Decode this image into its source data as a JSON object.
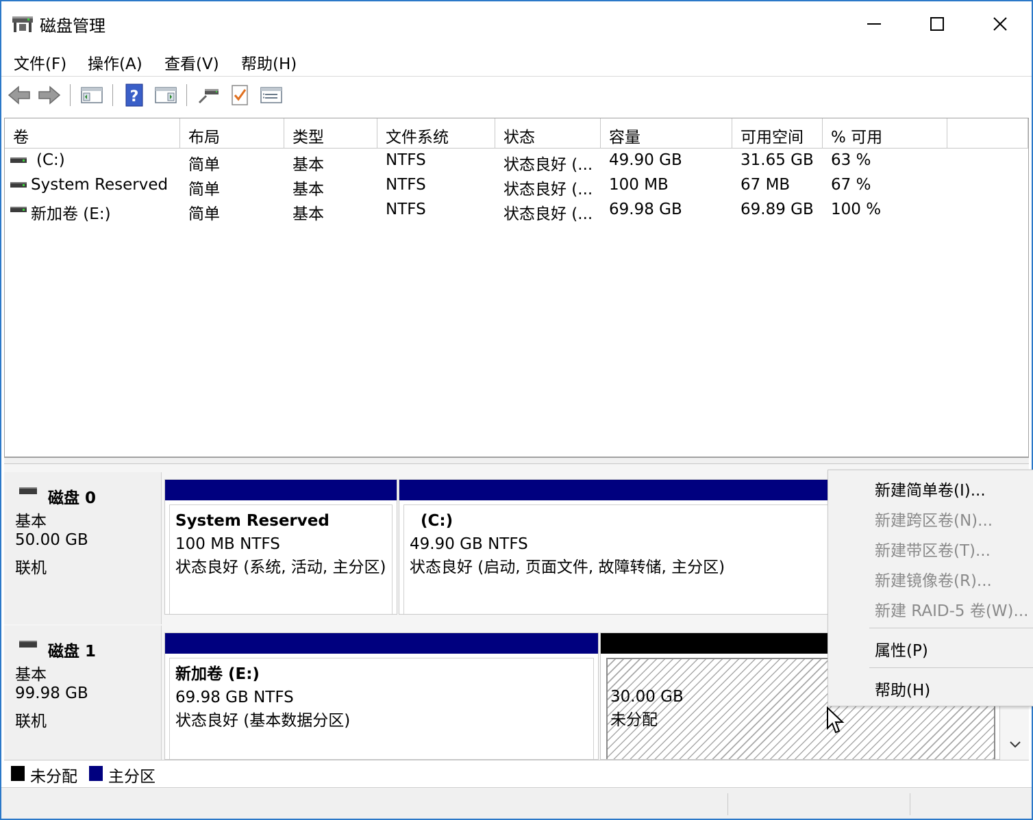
{
  "window": {
    "title": "磁盘管理"
  },
  "menu": {
    "file": "文件(F)",
    "action": "操作(A)",
    "view": "查看(V)",
    "help": "帮助(H)"
  },
  "volume_list": {
    "columns": [
      "卷",
      "布局",
      "类型",
      "文件系统",
      "状态",
      "容量",
      "可用空间",
      "% 可用"
    ],
    "rows": [
      [
        "(C:)",
        "简单",
        "基本",
        "NTFS",
        "状态良好 (...",
        "49.90 GB",
        "31.65 GB",
        "63 %"
      ],
      [
        "System Reserved",
        "简单",
        "基本",
        "NTFS",
        "状态良好 (...",
        "100 MB",
        "67 MB",
        "67 %"
      ],
      [
        "新加卷 (E:)",
        "简单",
        "基本",
        "NTFS",
        "状态良好 (...",
        "69.98 GB",
        "69.89 GB",
        "100 %"
      ]
    ]
  },
  "disks": [
    {
      "title": "磁盘 0",
      "type": "基本",
      "size": "50.00 GB",
      "status": "联机",
      "partitions": [
        {
          "name": "System Reserved",
          "size_fs": "100 MB NTFS",
          "status": "状态良好 (系统, 活动, 主分区)"
        },
        {
          "name": "(C:)",
          "size_fs": "49.90 GB NTFS",
          "status": "状态良好 (启动, 页面文件, 故障转储, 主分区)"
        }
      ]
    },
    {
      "title": "磁盘 1",
      "type": "基本",
      "size": "99.98 GB",
      "status": "联机",
      "partitions": [
        {
          "name": "新加卷  (E:)",
          "size_fs": "69.98 GB NTFS",
          "status": "状态良好 (基本数据分区)"
        },
        {
          "name": "",
          "size_fs": "30.00 GB",
          "status": "未分配"
        }
      ]
    }
  ],
  "legend": {
    "unallocated": "未分配",
    "primary": "主分区"
  },
  "context_menu": {
    "new_simple": "新建简单卷(I)...",
    "new_spanned": "新建跨区卷(N)...",
    "new_striped": "新建带区卷(T)...",
    "new_mirrored": "新建镜像卷(R)...",
    "new_raid5": "新建 RAID-5 卷(W)...",
    "properties": "属性(P)",
    "help": "帮助(H)"
  },
  "colors": {
    "primary_partition": "#00007f",
    "unallocated": "#000000",
    "window_border": "#2b78c8"
  },
  "icons": [
    "back-arrow-icon",
    "forward-arrow-icon",
    "console-tree-icon",
    "help-icon",
    "action-pane-icon",
    "connect-icon",
    "checklist-icon",
    "properties-icon"
  ]
}
